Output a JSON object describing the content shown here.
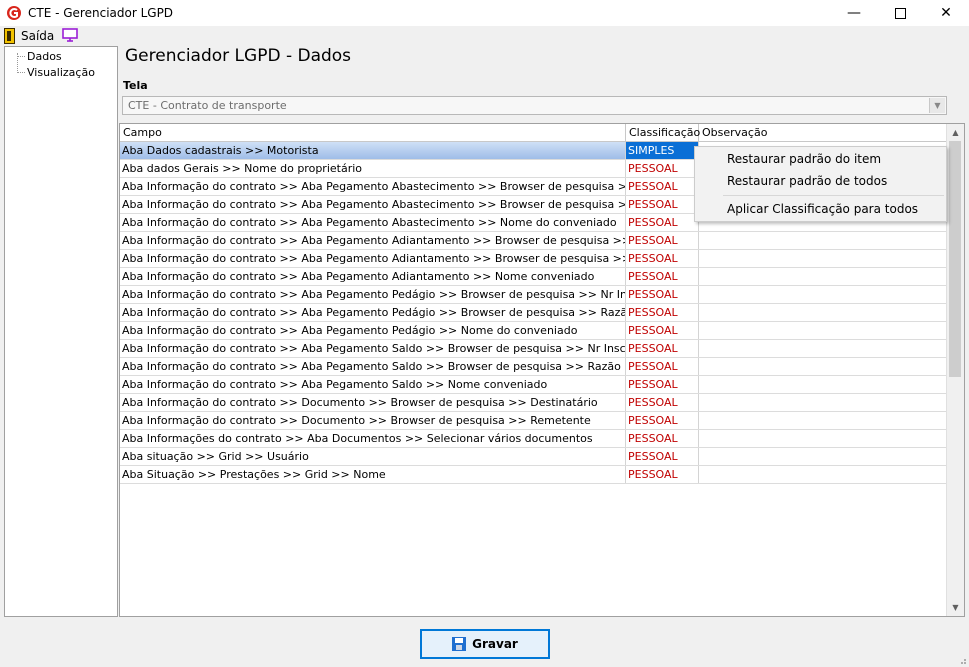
{
  "window": {
    "title": "CTE - Gerenciador LGPD"
  },
  "toolbar": {
    "exit_label": "Saída"
  },
  "tree": {
    "items": [
      {
        "label": "Dados"
      },
      {
        "label": "Visualização"
      }
    ]
  },
  "page": {
    "title": "Gerenciador LGPD - Dados",
    "tela_label": "Tela",
    "tela_value": "CTE - Contrato de transporte"
  },
  "grid": {
    "columns": [
      "Campo",
      "Classificação",
      "Observação"
    ],
    "rows": [
      {
        "campo": "Aba Dados cadastrais >> Motorista",
        "classificacao": "SIMPLES",
        "observacao": ""
      },
      {
        "campo": "Aba dados Gerais >> Nome do proprietário",
        "classificacao": "PESSOAL",
        "observacao": ""
      },
      {
        "campo": "Aba Informação do contrato >> Aba Pegamento Abastecimento >> Browser de pesquisa >> Nr Inscrição",
        "classificacao": "PESSOAL",
        "observacao": ""
      },
      {
        "campo": "Aba Informação do contrato >> Aba Pegamento Abastecimento >> Browser de pesquisa >> Razão Social",
        "classificacao": "PESSOAL",
        "observacao": ""
      },
      {
        "campo": "Aba Informação do contrato >> Aba Pegamento Abastecimento >> Nome do conveniado",
        "classificacao": "PESSOAL",
        "observacao": ""
      },
      {
        "campo": "Aba Informação do contrato >> Aba Pegamento Adiantamento >> Browser de pesquisa >> Nr Inscrição",
        "classificacao": "PESSOAL",
        "observacao": ""
      },
      {
        "campo": "Aba Informação do contrato >> Aba Pegamento Adiantamento >> Browser de pesquisa >> Razão Social",
        "classificacao": "PESSOAL",
        "observacao": ""
      },
      {
        "campo": "Aba Informação do contrato >> Aba Pegamento Adiantamento >> Nome conveniado",
        "classificacao": "PESSOAL",
        "observacao": ""
      },
      {
        "campo": "Aba Informação do contrato >> Aba Pegamento Pedágio >> Browser de pesquisa >> Nr Inscrição",
        "classificacao": "PESSOAL",
        "observacao": ""
      },
      {
        "campo": "Aba Informação do contrato >> Aba Pegamento Pedágio >> Browser de pesquisa >> Razão Social",
        "classificacao": "PESSOAL",
        "observacao": ""
      },
      {
        "campo": "Aba Informação do contrato >> Aba Pegamento Pedágio >> Nome do conveniado",
        "classificacao": "PESSOAL",
        "observacao": ""
      },
      {
        "campo": "Aba Informação do contrato >> Aba Pegamento Saldo >> Browser de pesquisa >> Nr Inscrição",
        "classificacao": "PESSOAL",
        "observacao": ""
      },
      {
        "campo": "Aba Informação do contrato >> Aba Pegamento Saldo >> Browser de pesquisa >> Razão Social",
        "classificacao": "PESSOAL",
        "observacao": ""
      },
      {
        "campo": "Aba Informação do contrato >> Aba Pegamento Saldo >> Nome conveniado",
        "classificacao": "PESSOAL",
        "observacao": ""
      },
      {
        "campo": "Aba Informação do contrato >> Documento >> Browser de pesquisa >> Destinatário",
        "classificacao": "PESSOAL",
        "observacao": ""
      },
      {
        "campo": "Aba Informação do contrato >> Documento >> Browser de pesquisa >> Remetente",
        "classificacao": "PESSOAL",
        "observacao": ""
      },
      {
        "campo": "Aba Informações do contrato >> Aba Documentos >> Selecionar vários documentos",
        "classificacao": "PESSOAL",
        "observacao": ""
      },
      {
        "campo": "Aba situação >> Grid >> Usuário",
        "classificacao": "PESSOAL",
        "observacao": ""
      },
      {
        "campo": "Aba Situação >> Prestações >> Grid >> Nome",
        "classificacao": "PESSOAL",
        "observacao": ""
      }
    ]
  },
  "context_menu": {
    "items": [
      "Restaurar padrão do item",
      "Restaurar padrão de todos",
      "Aplicar Classificação para todos"
    ]
  },
  "buttons": {
    "save_label": "Gravar"
  },
  "colors": {
    "pessoal": "#c00000",
    "selected_cell": "#0a6fd6",
    "accent": "#0078d7"
  }
}
